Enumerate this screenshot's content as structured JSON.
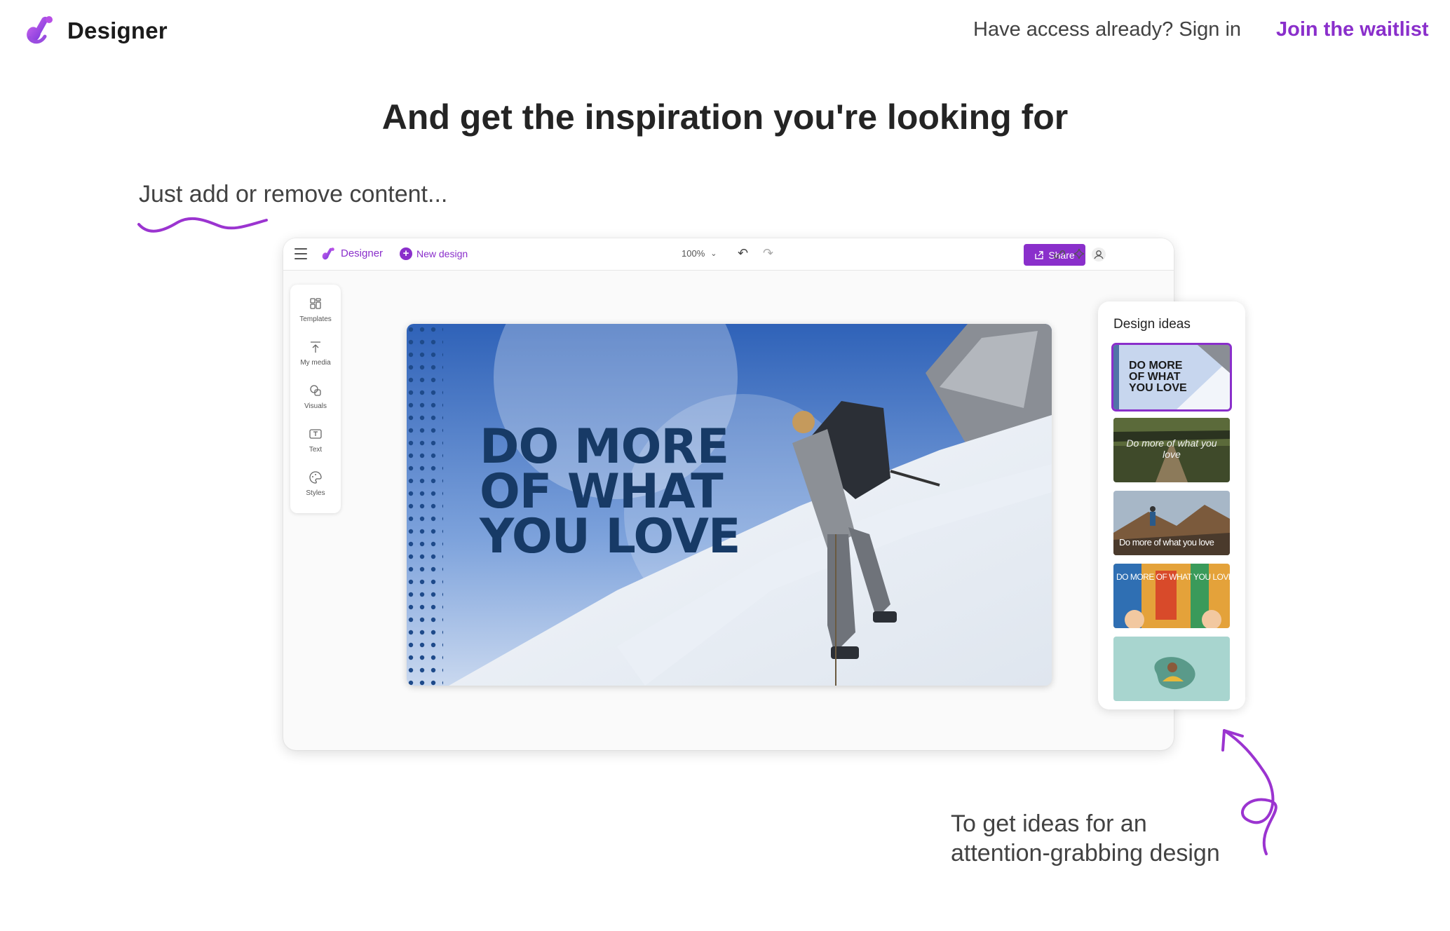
{
  "nav": {
    "brand_name": "Designer",
    "signin_text": "Have access already? Sign in",
    "waitlist_text": "Join the waitlist"
  },
  "headline": "And get the inspiration you're looking for",
  "caption_left": "Just add or remove content...",
  "caption_bottom_line1": "To get ideas for an",
  "caption_bottom_line2": "attention-grabbing design",
  "app": {
    "name": "Designer",
    "new_design": "New design",
    "zoom": "100%",
    "share": "Share",
    "rail": [
      {
        "label": "Templates",
        "icon": "templates-icon"
      },
      {
        "label": "My media",
        "icon": "upload-icon"
      },
      {
        "label": "Visuals",
        "icon": "visuals-icon"
      },
      {
        "label": "Text",
        "icon": "text-icon"
      },
      {
        "label": "Styles",
        "icon": "styles-icon"
      }
    ],
    "canvas_text": "DO MORE\nOF WHAT\nYOU LOVE",
    "ideas": {
      "title": "Design ideas",
      "items": [
        {
          "text": "DO MORE OF WHAT YOU LOVE"
        },
        {
          "text": "Do more of what you love"
        },
        {
          "text": "Do more of what you love"
        },
        {
          "text": "DO MORE OF WHAT YOU LOVE"
        },
        {
          "text": ""
        }
      ]
    }
  },
  "colors": {
    "accent": "#8a2fcb",
    "headline_text": "#242424",
    "canvas_title": "#173a66"
  }
}
